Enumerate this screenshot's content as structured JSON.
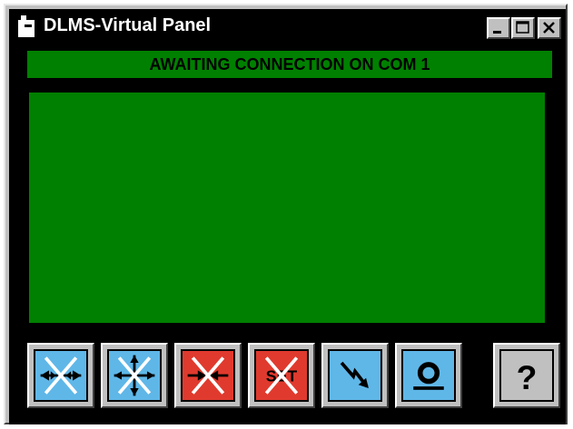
{
  "window": {
    "title": "DLMS-Virtual Panel",
    "controls": {
      "minimize": "minimize",
      "maximize": "maximize",
      "close": "close"
    }
  },
  "status": {
    "message": "AWAITING CONNECTION ON COM 1"
  },
  "toolbar": {
    "buttons": [
      {
        "icon": "arrows-horizontal-crossed-icon",
        "color": "#5fb7e8"
      },
      {
        "icon": "arrows-four-way-crossed-icon",
        "color": "#5fb7e8"
      },
      {
        "icon": "arrows-inward-crossed-icon",
        "color": "#e03a2e"
      },
      {
        "icon": "set-crossed-icon",
        "color": "#e03a2e"
      },
      {
        "icon": "lightning-arrow-icon",
        "color": "#5fb7e8"
      },
      {
        "icon": "record-disc-icon",
        "color": "#5fb7e8"
      },
      {
        "icon": "help-question-icon",
        "color": "#c0c0c0"
      }
    ],
    "set_text": "SET",
    "help_text": "?"
  },
  "colors": {
    "display_green": "#008000",
    "panel_black": "#000000",
    "face_blue": "#5fb7e8",
    "face_red": "#e03a2e",
    "face_gray": "#c0c0c0"
  }
}
